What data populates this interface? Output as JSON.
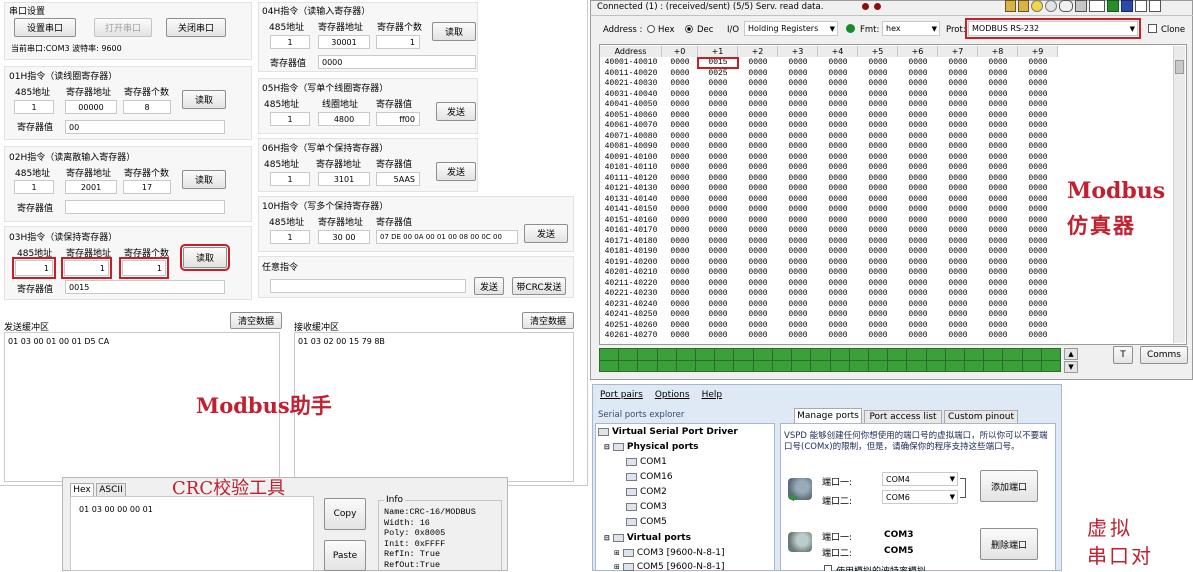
{
  "modbus_assistant": {
    "serial": {
      "title": "串口设置",
      "btn_set": "设置串口",
      "btn_open": "打开串口",
      "btn_close": "关闭串口",
      "status": "当前串口:COM3 波特率: 9600"
    },
    "labels": {
      "addr485": "485地址",
      "reg_addr": "寄存器地址",
      "reg_count": "寄存器个数",
      "reg_value": "寄存器值",
      "coil_addr": "线圈地址",
      "read": "读取",
      "send": "发送",
      "send_crc": "带CRC发送",
      "clear": "清空数据"
    },
    "f01": {
      "title": "01H指令（读线圈寄存器）",
      "addr": "1",
      "reg": "00000",
      "count": "8",
      "value": "00"
    },
    "f02": {
      "title": "02H指令（读离散输入寄存器）",
      "addr": "1",
      "reg": "2001",
      "count": "17",
      "value": ""
    },
    "f03": {
      "title": "03H指令（读保持寄存器）",
      "addr": "1",
      "reg": "1",
      "count": "1",
      "value": "0015"
    },
    "f04": {
      "title": "04H指令（读输入寄存器）",
      "addr": "1",
      "reg": "30001",
      "count": "1",
      "value": "0000"
    },
    "f05": {
      "title": "05H指令（写单个线圈寄存器）",
      "addr": "1",
      "reg": "4800",
      "value": "ff00"
    },
    "f06": {
      "title": "06H指令（写单个保持寄存器）",
      "addr": "1",
      "reg": "3101",
      "value": "5AAS"
    },
    "f10": {
      "title": "10H指令（写多个保持寄存器）",
      "addr": "1",
      "reg": "30 00",
      "value": "07 DE 00 0A 00 01 00 08 00 0C 00"
    },
    "custom": {
      "title": "任意指令",
      "value": ""
    },
    "send_buffer": {
      "title": "发送缓冲区",
      "content": "01 03 00 01 00 01 D5 CA"
    },
    "recv_buffer": {
      "title": "接收缓冲区",
      "content": "01 03 02 00 15 79 8B"
    }
  },
  "annotations": {
    "assistant": "Modbus助手",
    "crc": "CRC校验工具",
    "sim1": "Modbus",
    "sim2": "仿真器",
    "vsp1": "虚拟",
    "vsp2": "串口对"
  },
  "crc_tool": {
    "tab_hex": "Hex",
    "tab_ascii": "ASCII",
    "input": "01 03 00 00 00 01",
    "btn_copy": "Copy",
    "btn_paste": "Paste",
    "info_title": "Info",
    "info_lines": [
      "Name:CRC-16/MODBUS",
      "Width: 16",
      "Poly:  0x8005",
      "Init:  0xFFFF",
      "RefIn: True",
      "RefOut:True"
    ]
  },
  "simulator": {
    "status": "Connected (1) : (received/sent) (5/5) Serv. read data.",
    "address_label": "Address :",
    "hex": "Hex",
    "dec": "Dec",
    "io_label": "I/O",
    "io_value": "Holding Registers",
    "fmt_label": "Fmt:",
    "fmt_value": "hex",
    "prot_label": "Prot:",
    "prot_value": "MODBUS RS-232",
    "clone": "Clone",
    "columns": [
      "Address",
      "+0",
      "+1",
      "+2",
      "+3",
      "+4",
      "+5",
      "+6",
      "+7",
      "+8",
      "+9"
    ],
    "rows": [
      "40001-40010",
      "40011-40020",
      "40021-40030",
      "40031-40040",
      "40041-40050",
      "40051-40060",
      "40061-40070",
      "40071-40080",
      "40081-40090",
      "40091-40100",
      "40101-40110",
      "40111-40120",
      "40121-40130",
      "40131-40140",
      "40141-40150",
      "40151-40160",
      "40161-40170",
      "40171-40180",
      "40181-40190",
      "40191-40200",
      "40201-40210",
      "40211-40220",
      "40221-40230",
      "40231-40240",
      "40241-40250",
      "40251-40260",
      "40261-40270"
    ],
    "zero": "0000",
    "special": [
      {
        "r": 0,
        "c": 1,
        "v": "0015"
      },
      {
        "r": 1,
        "c": 1,
        "v": "0025"
      }
    ],
    "btn_t": "T",
    "btn_comms": "Comms"
  },
  "vspd": {
    "menu": [
      "Port pairs",
      "Options",
      "Help"
    ],
    "explorer": "Serial ports explorer",
    "tabs": [
      "Manage ports",
      "Port access list",
      "Custom pinout"
    ],
    "tree": {
      "root": "Virtual Serial Port Driver",
      "physical": "Physical ports",
      "phys_ports": [
        "COM1",
        "COM16",
        "COM2",
        "COM3",
        "COM5"
      ],
      "virtual": "Virtual ports",
      "virt_ports": [
        "COM3 [9600-N-8-1]",
        "COM5 [9600-N-8-1]"
      ]
    },
    "desc": "VSPD 能够创建任何你想使用的端口号的虚拟端口，所以你可以不要端口号(COMx)的限制，但是，请确保你的程序支持这些端口号。",
    "port1_label": "端口一:",
    "port2_label": "端口二:",
    "add_port1": "COM4",
    "add_port2": "COM6",
    "btn_add": "添加端口",
    "del_port1": "COM3",
    "del_port2": "COM5",
    "btn_del": "删除端口",
    "checkbox": "使用模拟的波特率模拟"
  }
}
